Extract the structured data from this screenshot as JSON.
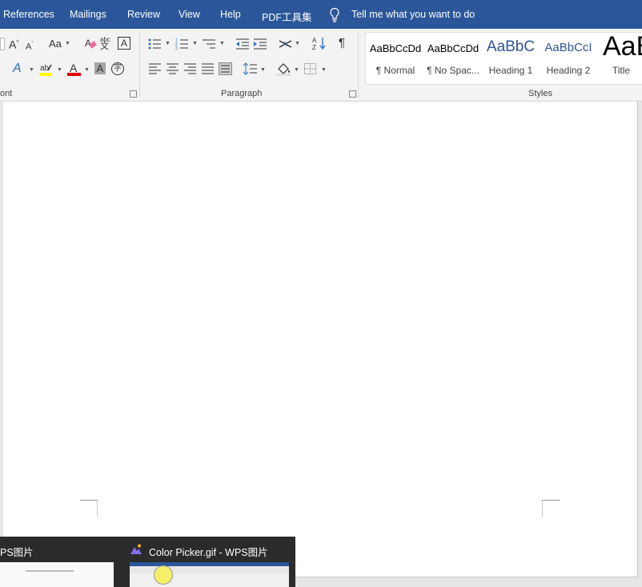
{
  "tabs": {
    "references": "References",
    "mailings": "Mailings",
    "review": "Review",
    "view": "View",
    "help": "Help",
    "pdf": "PDF工具集"
  },
  "tell_me": "Tell me what you want to do",
  "font_group": {
    "label": "ont",
    "grow_font": "A",
    "shrink_font": "A",
    "change_case": "Aa",
    "text_effects": "A",
    "font_color": "A",
    "char_shading": "A",
    "char_border": "A",
    "phonetic": "abc",
    "enclose": "字",
    "highlight_color": "#ffff00",
    "font_color_value": "#e00000"
  },
  "paragraph_group": {
    "label": "Paragraph",
    "show_marks": "¶"
  },
  "styles_group": {
    "label": "Styles",
    "items": [
      {
        "sample": "AaBbCcDd",
        "name": "¶ Normal"
      },
      {
        "sample": "AaBbCcDd",
        "name": "¶ No Spac..."
      },
      {
        "sample": "AaBbC",
        "name": "Heading 1"
      },
      {
        "sample": "AaBbCcI",
        "name": "Heading 2"
      },
      {
        "sample": "AaB",
        "name": "Title"
      }
    ]
  },
  "taskbar": {
    "items": [
      {
        "title": "PS图片"
      },
      {
        "title": "Color Picker.gif - WPS图片"
      }
    ]
  },
  "colors": {
    "ribbon_tab_bg": "#2b579a",
    "heading_blue": "#2f5496",
    "thumb_bg": "#2b2b2b"
  }
}
